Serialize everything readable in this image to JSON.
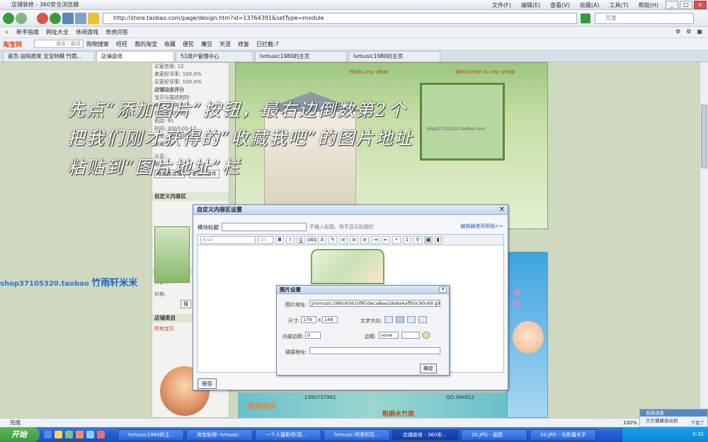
{
  "window": {
    "title": "店铺装修 - 360安全浏览器",
    "menus": [
      "文件(F)",
      "编辑(E)",
      "查看(V)",
      "收藏(A)",
      "工具(T)",
      "帮助(H)"
    ]
  },
  "address": {
    "url": "http://store.taobao.com/page/design.htm?id=13764391&setType=module",
    "search_placeholder": "百度"
  },
  "favorites": [
    "新手指南",
    "网址大全",
    "休闲游戏",
    "奇虎问答"
  ],
  "toolbar": {
    "logo": "淘宝网",
    "search_placeholder": "搜索・翻译",
    "items": [
      "购物搜索",
      "旺旺",
      "我的淘宝",
      "收藏",
      "便民",
      "魔豆",
      "天涯",
      "修复",
      "已拦截:7"
    ]
  },
  "tabs": [
    "首页-益阳原席 宝宝特模 竹雨...",
    "店铺装修",
    "51用户管理中心",
    "lvmusic1980的主页",
    "lvmusic1980的主页"
  ],
  "left_panel": {
    "lines": [
      "买家信用: 12",
      "卖家好评率: 100.0%",
      "买家好评率: 100.0%",
      "店铺动态评分",
      "宝贝与描述相符:",
      "卖家的服务态度:",
      "卖家发货的速度:",
      "创店: 91",
      "时间: 2007-02-12",
      "地址: 湖南益阳",
      "收藏: 14"
    ],
    "auth_label": "认证:",
    "service_label": "服务:",
    "collect_btn": "收藏本店铺",
    "message_btn": "发站内信件",
    "custom_section": "自定义内容区",
    "thumb_caption": "SHOP37105320",
    "search_section": "搜索店内宝贝",
    "keyword_label": "关键字:",
    "price_label": "价格:",
    "search_btn": "搜",
    "category_section": "店铺类目",
    "all_items": "所有宝贝"
  },
  "banner": {
    "sign_left": "Hello,my dear",
    "sign_right": "Welcome to my shop",
    "watermark": "shop37105320.taobao.com",
    "phone_left": "1390737982",
    "phone_right": "QQ:384912",
    "brand_left": "家居装饰",
    "brand_mid": "粗麻水竹席"
  },
  "overlay": {
    "line1": "先点“添加图片”按钮，最右边倒数第2个",
    "line2": "把我们刚才获得的“收藏我吧”的图片地址",
    "line3": "粘贴到“图片地址”栏",
    "shop_url": "shop37105320.taobao",
    "shop_name": "竹雨轩米米"
  },
  "dialog": {
    "title": "自定义内容区设置",
    "module_title_label": "模块标题",
    "module_hint": "不输入标题，则不显示标题栏",
    "help_link": "编辑器使用帮助>>",
    "font_placeholder": "Arial",
    "size_placeholder": "10",
    "save_btn": "保存"
  },
  "image_dialog": {
    "title": "图片设置",
    "url_label": "图片地址:",
    "url_value": "J/lvmusic1980/65610f85deca8ee2de8a4affb0c90c69.gif",
    "size_label": "尺寸:",
    "width": "179",
    "height": "149",
    "size_x": "X",
    "direction_label": "文字方向:",
    "padding_label": "内部边距:",
    "padding_value": "0",
    "border_label": "边框:",
    "border_style": "none",
    "link_label": "链接地址:",
    "link_value": "",
    "ok_btn": "确定"
  },
  "status": {
    "text": "完成",
    "zoom": "100%"
  },
  "notification": {
    "title": "系统消息",
    "body": "贝贝健康自动员",
    "close": "下载了"
  },
  "taskbar": {
    "start": "开始",
    "tasks": [
      "lvmusic1980的主...",
      "淘宝助理--lvmusic",
      "一个人摄影吧(现...",
      "lvmusic-阿里旺旺...",
      "店铺装修 - 360安...",
      "20.JPG - 画图",
      "20.JPG - 光影魔术手"
    ],
    "clock": "0:32"
  }
}
